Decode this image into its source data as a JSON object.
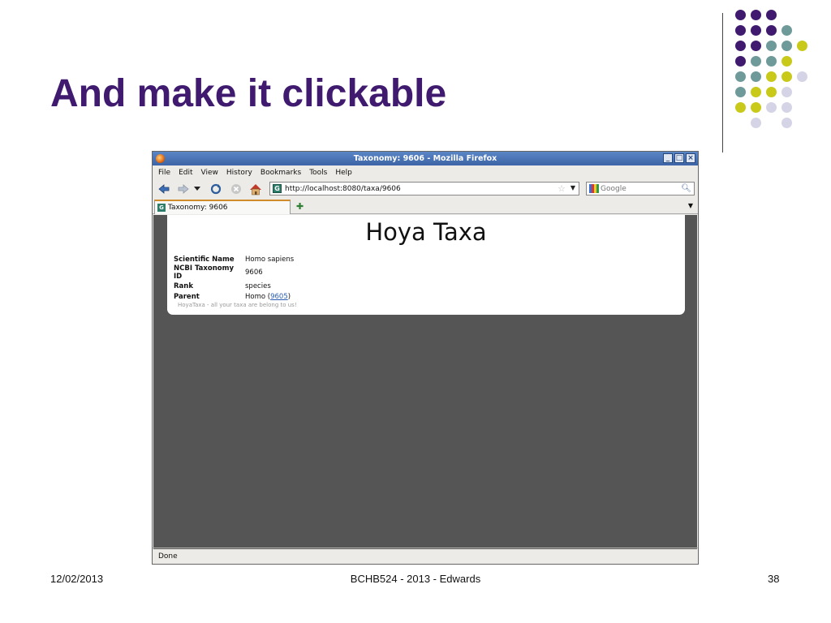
{
  "slide": {
    "title": "And make it clickable",
    "footer_left": "12/02/2013",
    "footer_center": "BCHB524 - 2013 - Edwards",
    "footer_right": "38"
  },
  "colors": {
    "title": "#3f1a6e",
    "dot_purple": "#3f1a6e",
    "dot_teal": "#6e9a9a",
    "dot_yellow": "#c9c91a",
    "dot_lavender": "#d4d4e6"
  },
  "browser": {
    "window_title": "Taxonomy: 9606 - Mozilla Firefox",
    "window_buttons": [
      "_",
      "□",
      "×"
    ],
    "menu": [
      "File",
      "Edit",
      "View",
      "History",
      "Bookmarks",
      "Tools",
      "Help"
    ],
    "nav_icons": [
      "back-icon",
      "forward-icon",
      "history-dropdown-icon",
      "reload-icon",
      "stop-icon",
      "home-icon"
    ],
    "url": "http://localhost:8080/taxa/9606",
    "search_placeholder": "Google",
    "tab_title": "Taxonomy: 9606",
    "status": "Done"
  },
  "page": {
    "heading": "Hoya Taxa",
    "rows": [
      {
        "label": "Scientific Name",
        "value": "Homo sapiens"
      },
      {
        "label": "NCBI Taxonomy ID",
        "value": "9606"
      },
      {
        "label": "Rank",
        "value": "species"
      }
    ],
    "parent": {
      "label": "Parent",
      "name": "Homo",
      "open": " (",
      "link": "9605",
      "close": ")"
    },
    "tagline": "HoyaTaxa - all your taxa are belong to us!"
  }
}
